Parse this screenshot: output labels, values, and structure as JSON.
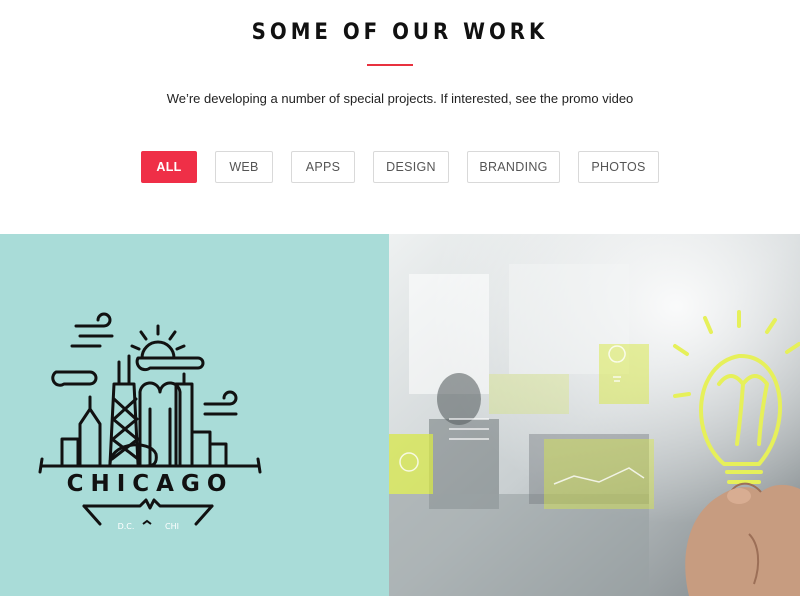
{
  "section": {
    "title": "SOME OF OUR WORK",
    "subtitle": "We’re developing a number of special projects. If interested, see the promo video"
  },
  "filters": [
    {
      "label": "ALL",
      "active": true
    },
    {
      "label": "WEB",
      "active": false
    },
    {
      "label": "APPS",
      "active": false
    },
    {
      "label": "DESIGN",
      "active": false
    },
    {
      "label": "BRANDING",
      "active": false
    },
    {
      "label": "PHOTOS",
      "active": false
    }
  ],
  "portfolio": {
    "chicago": {
      "city": "CHICAGO",
      "left_code": "D.C.",
      "right_code": "CHI",
      "background": "#a9dcd8"
    },
    "office": {
      "accent": "#e6f05a"
    }
  },
  "colors": {
    "accent": "#ef2f47",
    "underline": "#e8313f"
  }
}
